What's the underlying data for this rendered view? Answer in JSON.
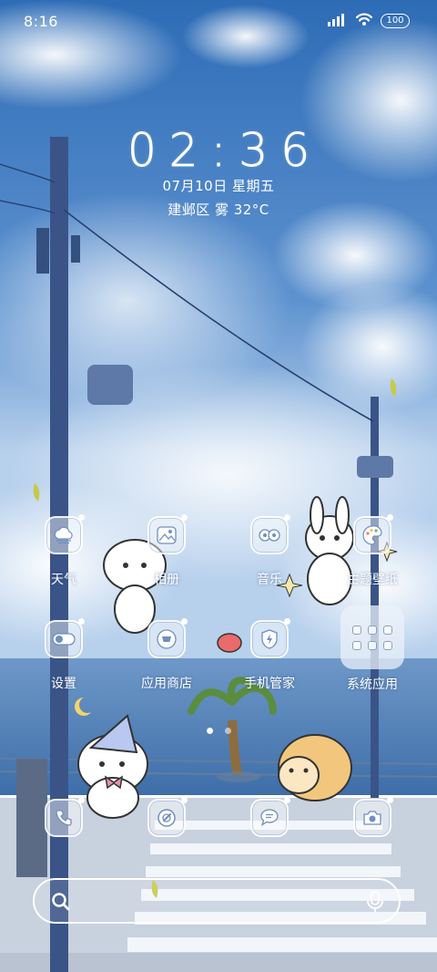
{
  "status_bar": {
    "time": "8:16",
    "battery": "100",
    "icons": [
      "signal-icon",
      "wifi-icon",
      "battery-icon"
    ]
  },
  "clock": {
    "time": "02:36",
    "date": "07月10日 星期五",
    "weather": "建邺区 雾 32°C"
  },
  "apps": {
    "row1": [
      {
        "label": "天气",
        "icon": "weather-icon"
      },
      {
        "label": "相册",
        "icon": "gallery-icon"
      },
      {
        "label": "音乐",
        "icon": "music-icon"
      },
      {
        "label": "主题壁纸",
        "icon": "theme-icon"
      }
    ],
    "row2": [
      {
        "label": "设置",
        "icon": "settings-icon"
      },
      {
        "label": "应用商店",
        "icon": "app-store-icon"
      },
      {
        "label": "手机管家",
        "icon": "security-icon"
      },
      {
        "label": "系统应用",
        "icon": "folder-icon"
      }
    ]
  },
  "dock": [
    {
      "icon": "phone-icon"
    },
    {
      "icon": "browser-icon"
    },
    {
      "icon": "messages-icon"
    },
    {
      "icon": "camera-icon"
    }
  ],
  "search": {
    "icons": [
      "search-icon",
      "mic-icon"
    ]
  },
  "page_indicator": {
    "pages": 2,
    "current": 1
  },
  "colors": {
    "sky_top": "#2f6fb8",
    "sky_bottom": "#a9c8ea",
    "sea": "#4f7fb4",
    "road": "#c9d2df"
  }
}
